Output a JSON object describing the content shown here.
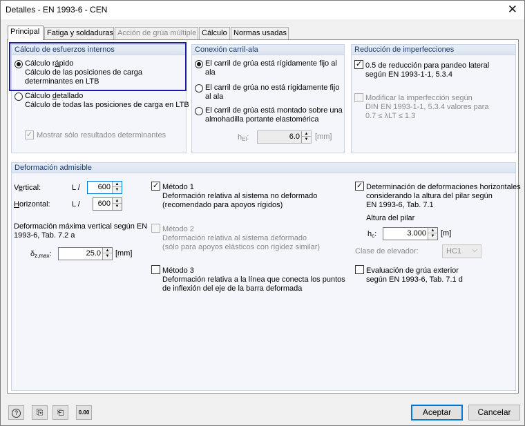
{
  "window": {
    "title": "Detalles - EN 1993-6 - CEN",
    "close_glyph": "✕"
  },
  "tabs": [
    {
      "label": "Principal"
    },
    {
      "label": "Fatiga y soldaduras"
    },
    {
      "label": "Acción de grúa múltiple"
    },
    {
      "label": "Cálculo"
    },
    {
      "label": "Normas usadas"
    }
  ],
  "internal_forces": {
    "header": "Cálculo de esfuerzos internos",
    "fast": {
      "label_pre": "Cálculo r",
      "label_key": "á",
      "label_post": "pido",
      "description": [
        "Cálculo de las posiciones de carga",
        "determinantes en LTB"
      ]
    },
    "detailed": {
      "label_pre": "Cálculo ",
      "label_key": "d",
      "label_post": "etallado",
      "description": "Cálculo de todas las posiciones de carga en LTB"
    },
    "show_determinant": "Mostrar sólo resultados determinantes"
  },
  "rail_connection": {
    "header": "Conexión carril-ala",
    "options": [
      [
        "El carril de grúa está rígidamente fijo al",
        "ala"
      ],
      [
        "El carril de grúa no está rígidamente fijo",
        "al ala"
      ],
      [
        "El carril de grúa está montado sobre una",
        "almohadilla portante elastomérica"
      ]
    ],
    "hel_label": "h",
    "hel_sub": "El",
    "hel_colon": ":",
    "hel_value": "6.0",
    "hel_unit": "[mm]"
  },
  "imperfection": {
    "header": "Reducción de imperfecciones",
    "reduction": [
      "0.5 de reducción para pandeo lateral",
      "según EN 1993-1-1, 5.3.4"
    ],
    "modify": [
      "Modificar la imperfección según",
      "DIN EN 1993-1-1, 5.3.4 valores para",
      "0.7 ≤ λLT ≤ 1.3"
    ]
  },
  "deformation": {
    "header": "Deformación admisible",
    "vertical_key": "e",
    "vertical_pre": "V",
    "vertical_post": "rtical:",
    "horizontal_key": "H",
    "horizontal_post": "orizontal:",
    "l_prefix": "L /",
    "vertical_value": "600",
    "horizontal_value": "600",
    "max_vertical_label": [
      "Deformación máxima vertical según EN",
      "1993-6, Tab. 7.2 a"
    ],
    "delta_label": "δ",
    "delta_sub": "z,max",
    "delta_colon": ":",
    "delta_value": "25.0",
    "delta_unit": "[mm]",
    "method1": {
      "title": "Método 1",
      "description": [
        "Deformación relativa al sistema no deformado",
        "(recomendado para apoyos rígidos)"
      ]
    },
    "method2": {
      "title": "Método 2",
      "description": [
        "Deformación relativa al sistema deformado",
        "(sólo para apoyos elásticos con rigidez similar)"
      ]
    },
    "method3": {
      "title": "Método 3",
      "description": [
        "Deformación relativa a la línea que conecta los puntos",
        "de inflexión del eje de la barra deformada"
      ]
    },
    "horizontal_det": [
      "Determinación de deformaciones horizontales",
      "considerando la altura del pilar según",
      "EN 1993-6, Tab. 7.1"
    ],
    "column_height_label": "Altura del pilar",
    "hc_label": "h",
    "hc_sub": "c",
    "hc_colon": ":",
    "hc_value": "3.000",
    "hc_unit": "[m]",
    "crane_class_label": "Clase de elevador:",
    "crane_class_value": "HC1",
    "outdoor": [
      "Evaluación de grúa exterior",
      "según EN 1993-6, Tab. 7.1 d"
    ]
  },
  "footer": {
    "accept": "Aceptar",
    "cancel": "Cancelar",
    "icon_units_label": "0.00"
  }
}
